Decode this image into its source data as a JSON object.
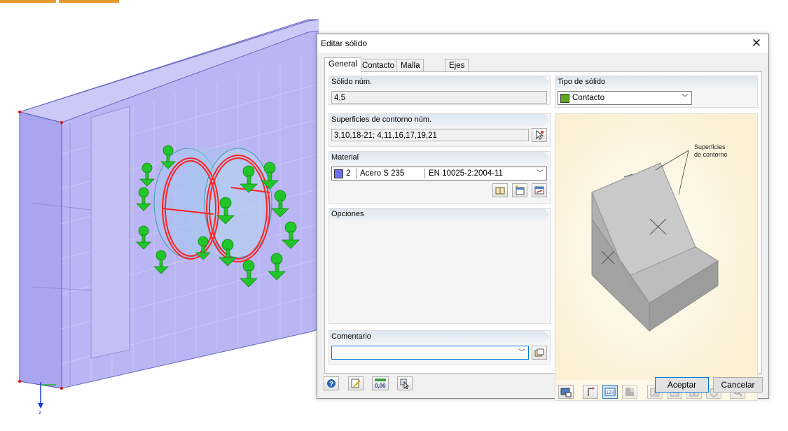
{
  "dialog": {
    "title": "Editar sólido",
    "tabs": [
      {
        "label": "General",
        "active": true
      },
      {
        "label": "Contacto",
        "active": false
      },
      {
        "label": "Malla de EF",
        "active": false
      },
      {
        "label": "Ejes",
        "active": false
      }
    ],
    "solid_no": {
      "label": "Sólido núm.",
      "value": "4,5"
    },
    "boundary": {
      "label": "Superficies de contorno núm.",
      "value": "3,10,18-21; 4,11,16,17,19,21"
    },
    "material": {
      "label": "Material",
      "number": "2",
      "name": "Acero S 235",
      "standard": "EN 10025-2:2004-11",
      "color": "#6f6ff0"
    },
    "options": {
      "label": "Opciones"
    },
    "comment": {
      "label": "Comentario",
      "value": ""
    },
    "solid_type": {
      "label": "Tipo de sólido",
      "value": "Contacto",
      "color": "#5aa81e"
    },
    "preview": {
      "annotation_line1": "Superficies",
      "annotation_line2": "de contorno"
    },
    "buttons": {
      "ok": "Aceptar",
      "cancel": "Cancelar"
    }
  },
  "viewport": {
    "axis_label": "z"
  },
  "colors": {
    "model_fill": "#b9b6f3",
    "edge": "#6d68c2",
    "load": "#22c52a",
    "highlight": "#ff2222",
    "accent": "#e69a2e"
  }
}
